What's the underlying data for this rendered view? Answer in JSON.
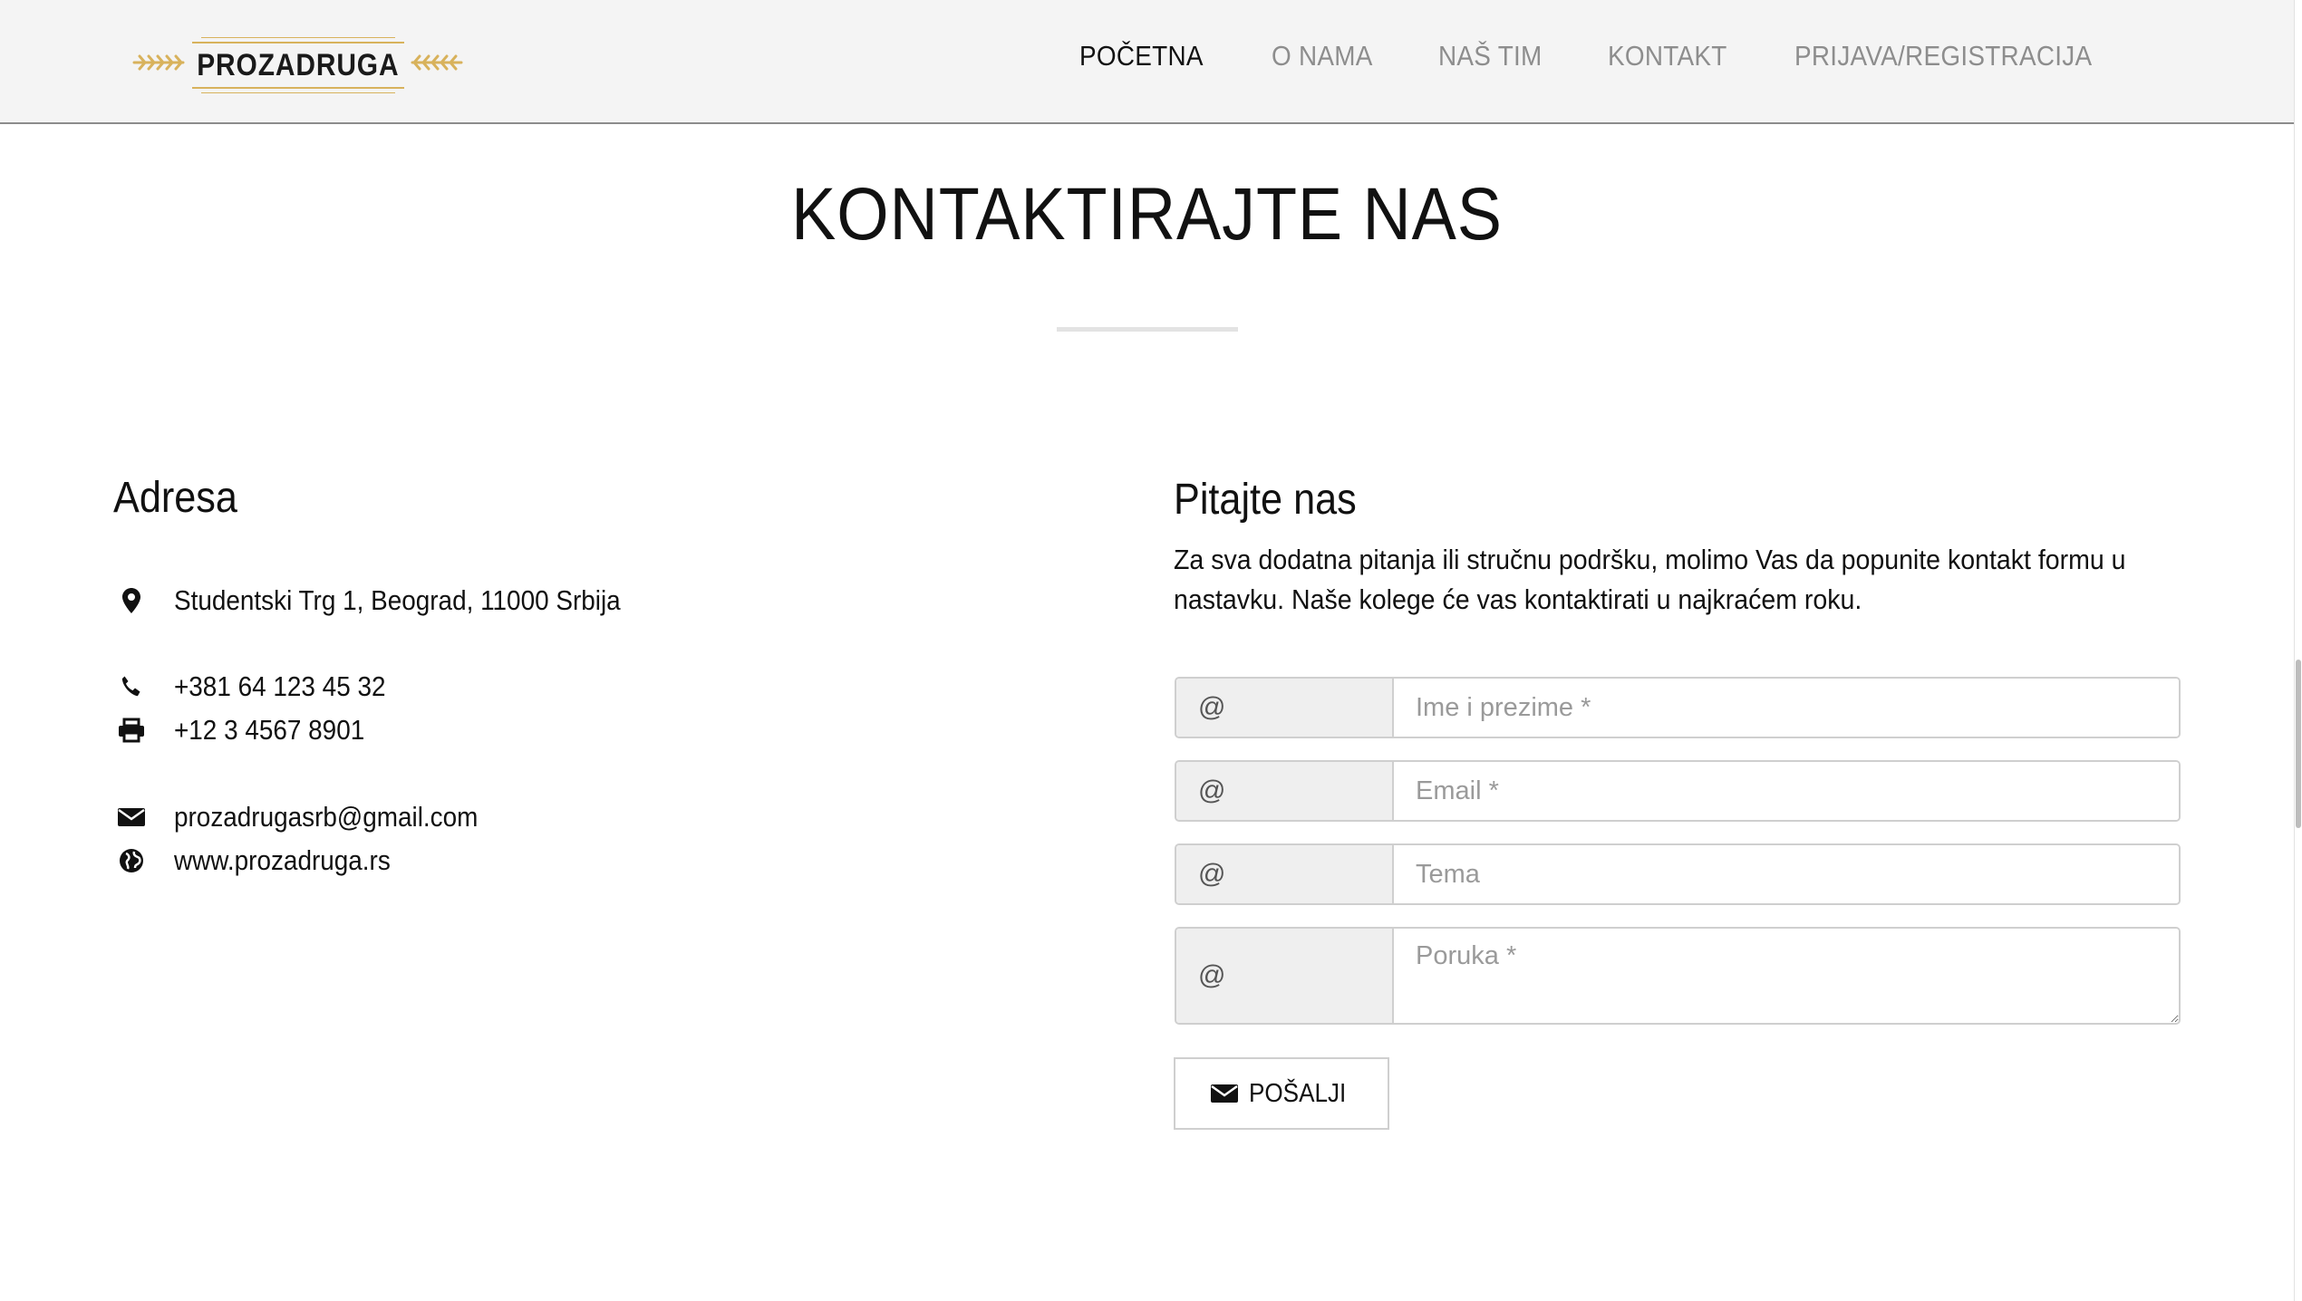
{
  "header": {
    "logo_text": "PROZADRUGA",
    "nav": [
      {
        "label": "POČETNA",
        "active": true
      },
      {
        "label": "O NAMA",
        "active": false
      },
      {
        "label": "NAŠ TIM",
        "active": false
      },
      {
        "label": "KONTAKT",
        "active": false
      },
      {
        "label": "PRIJAVA/REGISTRACIJA",
        "active": false
      }
    ]
  },
  "page": {
    "title": "KONTAKTIRAJTE NAS"
  },
  "address_section": {
    "heading": "Adresa",
    "address": "Studentski Trg 1, Beograd, 11000 Srbija",
    "phone": "+381 64 123 45 32",
    "fax": "+12 3 4567 8901",
    "email": "prozadrugasrb@gmail.com",
    "website": "www.prozadruga.rs",
    "icons": [
      "map-marker-icon",
      "phone-icon",
      "printer-icon",
      "envelope-icon",
      "globe-icon"
    ]
  },
  "form_section": {
    "heading": "Pitajte nas",
    "description": "Za sva dodatna pitanja ili stručnu podršku, molimo Vas da popunite kontakt formu u nastavku. Naše kolege će vas kontaktirati u najkraćem roku.",
    "addon_symbol": "@",
    "fields": {
      "name_placeholder": "Ime i prezime *",
      "email_placeholder": "Email *",
      "subject_placeholder": "Tema",
      "message_placeholder": "Poruka *"
    },
    "submit_label": "POŠALJI"
  },
  "colors": {
    "header_bg": "#f4f4f4",
    "nav_inactive": "#8d8d8d",
    "nav_active": "#111111",
    "logo_gold": "#d8b25c",
    "addon_bg": "#efefef"
  }
}
